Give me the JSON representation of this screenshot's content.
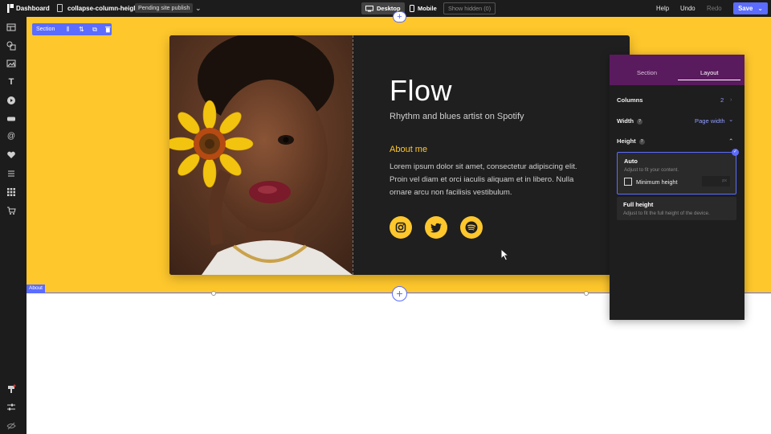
{
  "topbar": {
    "dashboard_label": "Dashboard",
    "page_name": "collapse-column-height",
    "publish_status": "Pending site publish",
    "desktop_label": "Desktop",
    "mobile_label": "Mobile",
    "show_hidden_label": "Show hidden (0)",
    "help_label": "Help",
    "undo_label": "Undo",
    "redo_label": "Redo",
    "save_label": "Save"
  },
  "sidebar": {
    "icons": [
      "layout-icon",
      "shapes-icon",
      "image-icon",
      "text-icon",
      "play-icon",
      "button-icon",
      "at-icon",
      "heart-icon",
      "list-icon",
      "grid-icon",
      "cart-icon"
    ],
    "bottom_icons": [
      "paint-icon",
      "sliders-icon",
      "hide-icon"
    ]
  },
  "canvas": {
    "section_toolbar_label": "Section",
    "section_tag": "About",
    "colors": {
      "yellow": "#fec72c",
      "accent": "#5b6cff",
      "card_bg": "#1f1f1f"
    }
  },
  "card": {
    "title": "Flow",
    "subtitle": "Rhythm and blues artist on Spotify",
    "about_heading": "About me",
    "about_body": "Lorem ipsum dolor sit amet, consectetur adipiscing elit. Proin vel diam et orci iaculis aliquam et in libero. Nulla ornare arcu non facilisis vestibulum.",
    "social": [
      "instagram-icon",
      "twitter-icon",
      "spotify-icon"
    ]
  },
  "panel": {
    "tabs": {
      "section": "Section",
      "layout": "Layout"
    },
    "columns_label": "Columns",
    "columns_value": "2",
    "width_label": "Width",
    "width_value": "Page width",
    "height_label": "Height",
    "auto_title": "Auto",
    "auto_desc": "Adjust to fit your content.",
    "min_height_label": "Minimum height",
    "min_height_unit": "px",
    "full_title": "Full height",
    "full_desc": "Adjust to fit the full height of the device."
  }
}
